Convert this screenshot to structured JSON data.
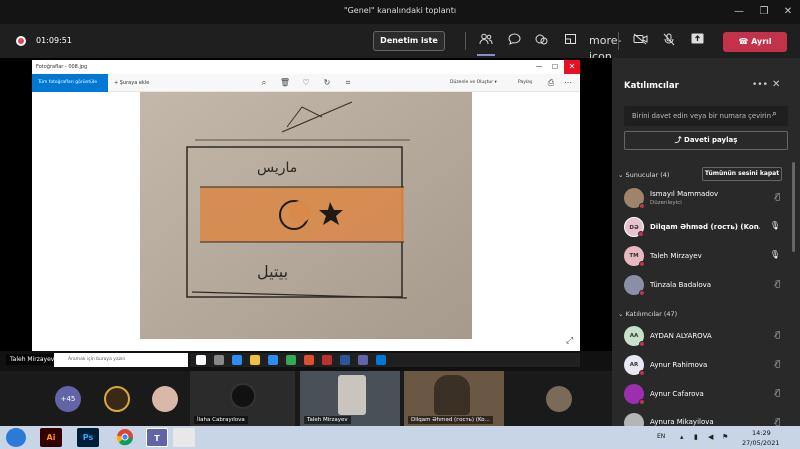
{
  "window": {
    "title": "\"Genel\" kanalındaki toplantı",
    "controls": [
      "—",
      "❐",
      "✕"
    ]
  },
  "toolbar": {
    "timer": "01:09:51",
    "denetim_label": "Denetim iste",
    "leave_label": "Ayrıl",
    "icons": [
      "people-icon",
      "chat-icon",
      "reactions-icon",
      "rooms-icon",
      "more-icon",
      "camera-off-icon",
      "mic-off-icon",
      "share-tray-icon"
    ]
  },
  "share_window": {
    "title": "Fotoğraflar - 008.jpg",
    "close_tooltip": "Kapat",
    "all_photos": "Tüm fotoğrafları görüntüle",
    "add_to": "+ Şuraya ekle",
    "edit_create": "Düzenle ve Oluştur ▾",
    "share": "Paylaş",
    "drawing_text_top": "ماريس",
    "drawing_text_bottom": "بيتيل"
  },
  "stage": {
    "presenter": "Taleh Mirzayev",
    "search_placeholder": "Aramak için buraya yazın",
    "mini_lang": "ENG"
  },
  "panel": {
    "title": "Katılımcılar",
    "invite_placeholder": "Birini davet edin veya bir numara çevirin",
    "share_invite": "Daveti paylaş",
    "presenters_header": "Sunucular (4)",
    "mute_all": "Tümünün sesini kapat",
    "attendees_header": "Katılımcılar (47)",
    "presenters": [
      {
        "name": "İsmayıl Mammadov",
        "role": "Düzenleyici",
        "initials": "",
        "color": "#a0846a",
        "mic": "muted"
      },
      {
        "name": "Dilqam Əhməd (гость) (Kon...",
        "role": "",
        "initials": "DƏ",
        "color": "#e9c2d0",
        "mic": "on"
      },
      {
        "name": "Taleh Mirzayev",
        "role": "",
        "initials": "TM",
        "color": "#e7b8c0",
        "mic": "on"
      },
      {
        "name": "Tünzala Badalova",
        "role": "",
        "initials": "",
        "color": "#8a8fa6",
        "mic": "muted"
      }
    ],
    "attendees": [
      {
        "name": "AYDAN ALYAROVA",
        "initials": "AA",
        "color": "#c6e0c9",
        "mic": "muted"
      },
      {
        "name": "Aynur Rahimova",
        "initials": "AR",
        "color": "#e8e8f4",
        "mic": "muted"
      },
      {
        "name": "Aynur Cafarova",
        "initials": "",
        "color": "#9c2fb0",
        "mic": "muted"
      },
      {
        "name": "Aynura Mikayilova",
        "initials": "",
        "color": "#b5b5b5",
        "mic": "muted"
      }
    ]
  },
  "gallery": {
    "overflow": "+45",
    "tiles": [
      {
        "label": "İlaha Cabrayılova"
      },
      {
        "label": "Taleh Mirzayev"
      },
      {
        "label": "Dilqam Əhməd (гость) (Ko..."
      }
    ]
  },
  "taskbar": {
    "apps": [
      "Ai",
      "Ps",
      "Chrome",
      "Teams",
      "Explorer"
    ],
    "lang": "EN",
    "time": "14:29",
    "date": "27/05/2021"
  },
  "colors": {
    "leave_red": "#c4314b",
    "teams_purple": "#6264a7",
    "photos_blue": "#0078d4"
  }
}
